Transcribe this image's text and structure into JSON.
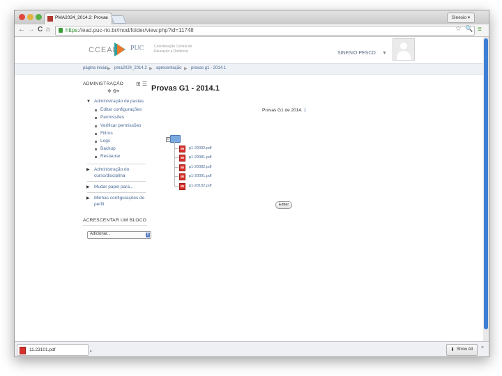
{
  "browser": {
    "tab_title": "PMA2024_2014.2: Provas",
    "tab_close": "×",
    "user_button": "Sinesio ▾",
    "url_scheme": "https",
    "url_rest": "://ead.puc-rio.br/mod/folder/view.php?id=11748",
    "nav_back": "←",
    "nav_forward": "→",
    "nav_reload": "C",
    "nav_home": "⌂",
    "star": "☆",
    "zoom": "🔍",
    "menu": "≡"
  },
  "header": {
    "logo_text": "CCEAD",
    "logo_puc": "PUC",
    "logo_sub": "Coordenação Central de Educação a Distância",
    "username": "SINESIO PESCO",
    "user_arrow": "▼"
  },
  "breadcrumb": {
    "items": [
      "página inicial",
      "pma2024_2014.2",
      "apresentação",
      "provas g1 - 2014.1"
    ],
    "separator": "▶"
  },
  "sidebar": {
    "admin_title": "ADMINISTRAÇÃO",
    "admin_icons": "⊞ ☰",
    "admin_tools": "✥ ✿▾",
    "folder_admin_label": "Administração de pastas",
    "folder_admin_items": [
      "Editar configurações",
      "Permissões",
      "Verificar permissões",
      "Filtros",
      "Logs",
      "Backup",
      "Restaurar"
    ],
    "course_admin_line1": "Administração do",
    "course_admin_line2": "curso/disciplina",
    "switch_role": "Mudar papel para...",
    "profile_line1": "Minhas configurações de",
    "profile_line2": "perfil",
    "add_block_title": "ACRESCENTAR UM BLOCO",
    "add_select_value": "Adicionar..."
  },
  "main": {
    "title": "Provas G1 - 2014.1",
    "folder_label_text": "Provas G1 de 2014.",
    "folder_label_link": "1",
    "tree_toggle": "⊟",
    "files": [
      "p1-20092.pdf",
      "p1-20081.pdf",
      "p1-20082.pdf",
      "p1-20091.pdf",
      "p1-20102.pdf"
    ],
    "edit_button": "Editar"
  },
  "downloads": {
    "file": "11.23101.pdf",
    "arrow": "▾",
    "show_all": "Show All",
    "close": "×"
  }
}
